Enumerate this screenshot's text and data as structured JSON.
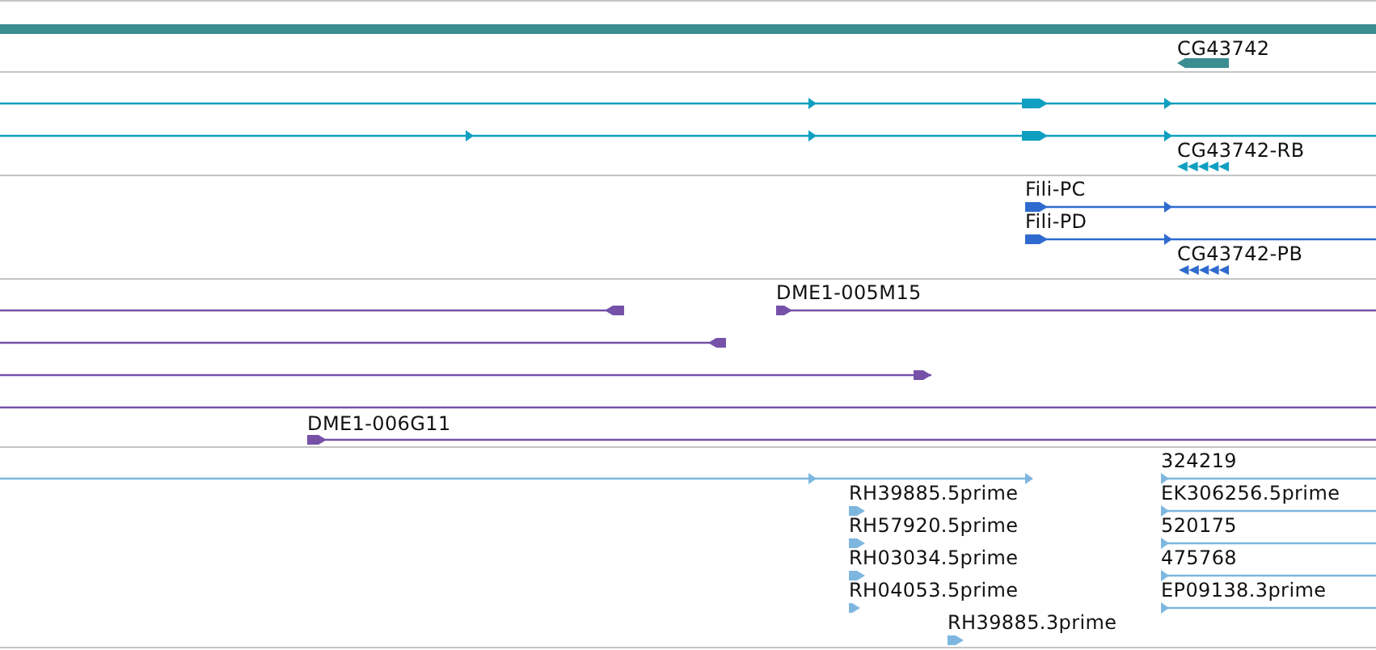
{
  "tracks": [
    {
      "color": "#3a8e92",
      "features": [
        {
          "label": "CG43742",
          "kind": "stranded",
          "reverse": true
        }
      ]
    },
    {
      "color": "#0f9fc1",
      "features": [
        {
          "kind": "stranded",
          "reverse": false
        },
        {
          "kind": "stranded",
          "reverse": false
        },
        {
          "label": "CG43742-RB",
          "kind": "stranded",
          "reverse": true
        }
      ]
    },
    {
      "color": "#2f6bcf",
      "features": [
        {
          "label": "Fili-PC",
          "kind": "stranded",
          "reverse": false
        },
        {
          "label": "Fili-PD",
          "kind": "stranded",
          "reverse": false
        },
        {
          "label": "CG43742-PB",
          "kind": "stranded",
          "reverse": true
        }
      ]
    },
    {
      "color": "#7552a8",
      "features": [
        {
          "kind": "stranded",
          "reverse": true
        },
        {
          "label": "DME1-005M15",
          "kind": "stranded",
          "reverse": false
        },
        {
          "kind": "stranded",
          "reverse": true
        },
        {
          "kind": "stranded",
          "reverse": false
        },
        {
          "kind": "plain"
        },
        {
          "label": "DME1-006G11",
          "kind": "stranded",
          "reverse": false
        }
      ]
    },
    {
      "color": "#7db7e0",
      "features": [
        {
          "kind": "stranded",
          "reverse": false
        },
        {
          "label": "324219",
          "kind": "stranded",
          "reverse": false
        },
        {
          "label": "RH39885.5prime",
          "kind": "stranded",
          "reverse": false
        },
        {
          "label": "EK306256.5prime",
          "kind": "stranded",
          "reverse": false
        },
        {
          "label": "RH57920.5prime",
          "kind": "stranded",
          "reverse": false
        },
        {
          "label": "520175",
          "kind": "stranded",
          "reverse": false
        },
        {
          "label": "RH03034.5prime",
          "kind": "stranded",
          "reverse": false
        },
        {
          "label": "475768",
          "kind": "stranded",
          "reverse": false
        },
        {
          "label": "RH04053.5prime",
          "kind": "stranded",
          "reverse": false
        },
        {
          "label": "EP09138.3prime",
          "kind": "stranded",
          "reverse": false
        },
        {
          "label": "RH39885.3prime",
          "kind": "stranded",
          "reverse": false
        }
      ]
    }
  ]
}
